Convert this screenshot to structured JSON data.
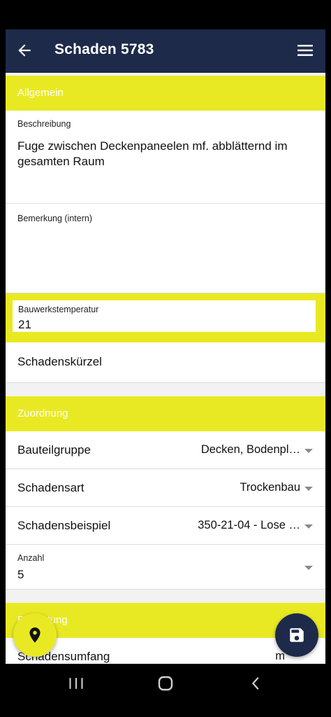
{
  "appbar": {
    "title": "Schaden 5783"
  },
  "sections": {
    "allgemein": "Allgemein",
    "zuordnung": "Zuordnung",
    "bewertung": "Bewertung"
  },
  "fields": {
    "beschreibung": {
      "label": "Beschreibung",
      "value": "Fuge zwischen Deckenpaneelen mf. abblätternd im gesamten Raum"
    },
    "bemerkung": {
      "label": "Bemerkung (intern)",
      "value": ""
    },
    "bauwerkstemperatur": {
      "label": "Bauwerkstemperatur",
      "value": "21"
    },
    "schadenskuerzel": {
      "label": "Schadenskürzel"
    },
    "anzahl": {
      "label": "Anzahl",
      "value": "5"
    }
  },
  "rows": {
    "bauteilgruppe": {
      "label": "Bauteilgruppe",
      "value": "Decken, Bodenpl…"
    },
    "schadensart": {
      "label": "Schadensart",
      "value": "Trockenbau"
    },
    "schadensbeispiel": {
      "label": "Schadensbeispiel",
      "value": "350-21-04 - Lose …"
    },
    "schadensumfang": {
      "label": "Schadensumfang",
      "value": "m"
    }
  },
  "colors": {
    "accent": "#e9e923",
    "navy": "#1e2a4a"
  }
}
